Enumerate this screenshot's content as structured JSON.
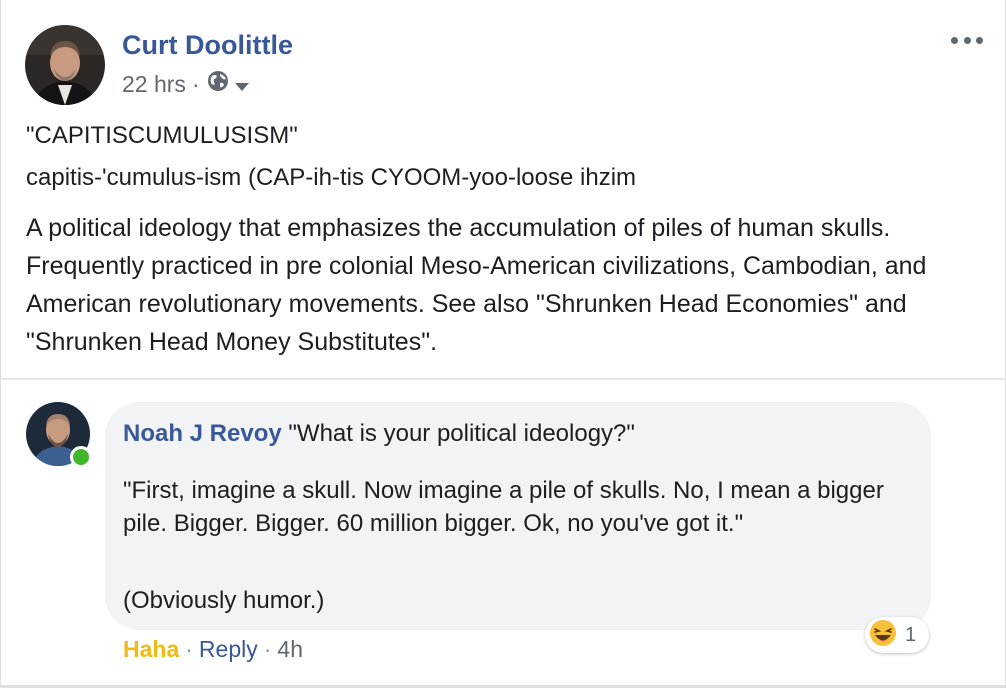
{
  "post": {
    "author": "Curt Doolittle",
    "time": "22 hrs",
    "dot": "·",
    "audience_icon": "globe-icon",
    "line1": "\"CAPITISCUMULUSISM\"",
    "line2": "capitis-'cumulus-ism (CAP-ih-tis CYOOM-yoo-loose ihzim",
    "body": "A political ideology that emphasizes the accumulation of piles of human skulls. Frequently practiced in pre colonial Meso-American civilizations, Cambodian, and American revolutionary movements. See also \"Shrunken Head Economies\" and \"Shrunken Head Money Substitutes\"."
  },
  "comment": {
    "author": "Noah J Revoy",
    "headline": "\"What is your political ideology?\"",
    "text1": "\"First, imagine a skull. Now imagine a pile of skulls. No, I mean a bigger pile. Bigger. Bigger. 60 million bigger. Ok, no you've got it.\"",
    "text2": "(Obviously humor.)",
    "reaction_count": "1",
    "reaction_icon": "haha-emoji-icon",
    "actions": {
      "haha": "Haha",
      "reply": "Reply",
      "time": "4h",
      "dot": "·"
    }
  },
  "colors": {
    "link": "#385898",
    "haha": "#f0ba15",
    "online": "#42b72a",
    "bubble": "#f2f3f5"
  }
}
